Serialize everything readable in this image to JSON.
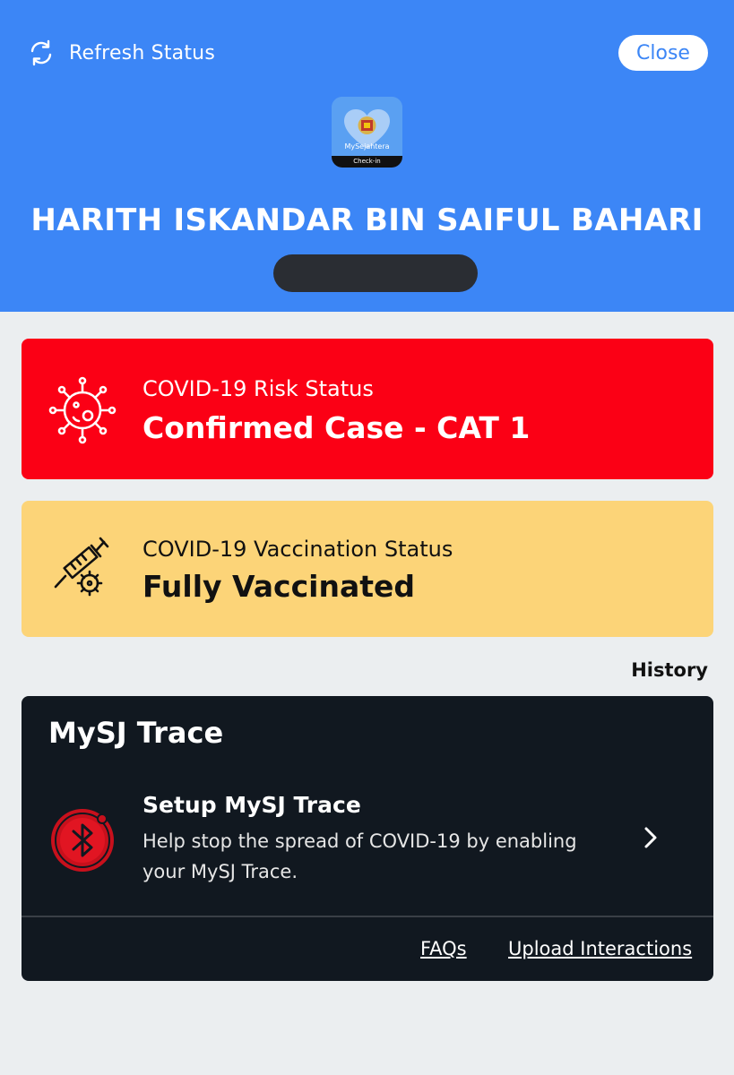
{
  "header": {
    "refresh_label": "Refresh Status",
    "close_label": "Close",
    "app_logo": {
      "name": "MySejahtera",
      "caption": "Check-in"
    },
    "user_name": "HARITH ISKANDAR BIN SAIFUL BAHARI",
    "background_color": "#3c86f6"
  },
  "risk_status": {
    "label": "COVID-19 Risk Status",
    "value": "Confirmed Case - CAT 1",
    "icon": "virus-icon",
    "color": "#fb0015"
  },
  "vaccination_status": {
    "label": "COVID-19 Vaccination Status",
    "value": "Fully Vaccinated",
    "icon": "vaccine-syringe-icon",
    "color": "#fcd478"
  },
  "history_label": "History",
  "trace": {
    "title": "MySJ Trace",
    "setup_title": "Setup MySJ Trace",
    "setup_description": "Help stop the spread of COVID-19 by enabling your MySJ Trace.",
    "icon": "bluetooth-icon",
    "links": {
      "faqs": "FAQs",
      "upload": "Upload Interactions"
    }
  }
}
